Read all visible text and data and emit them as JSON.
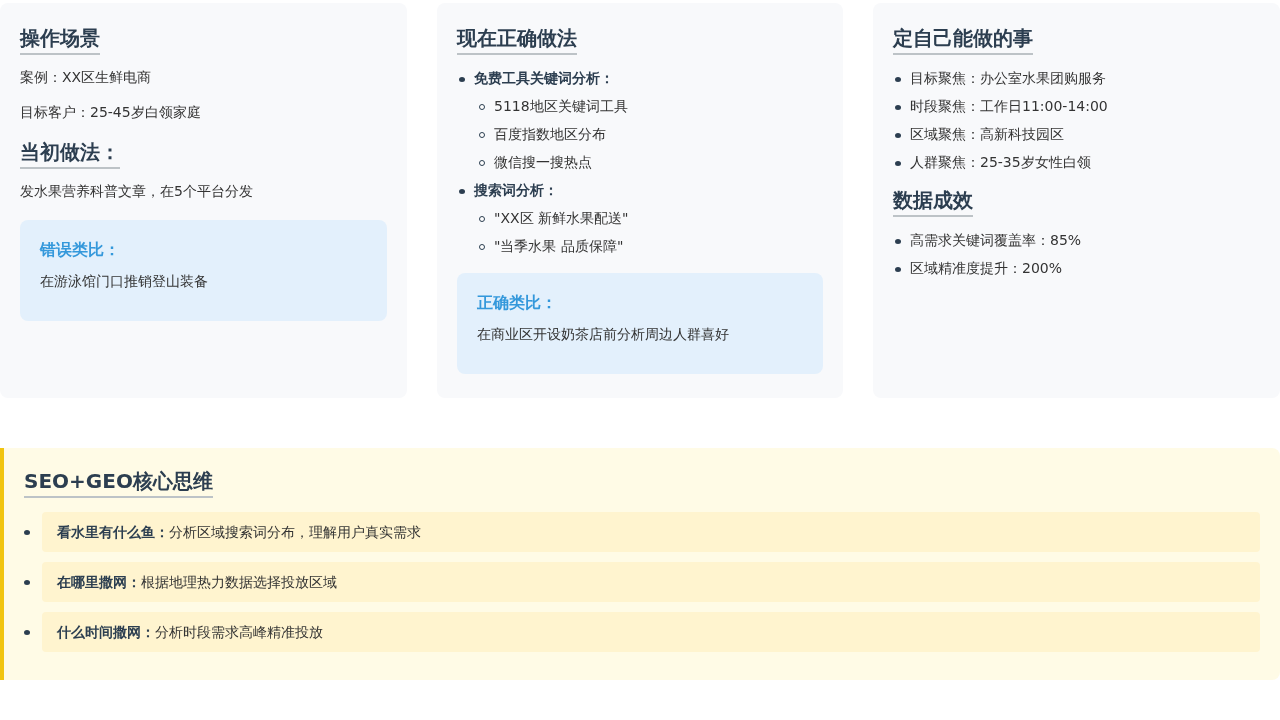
{
  "cards": [
    {
      "blocks": [
        {
          "kind": "heading",
          "text": "操作场景"
        },
        {
          "kind": "paragraph",
          "text": "案例：XX区生鲜电商"
        },
        {
          "kind": "paragraph",
          "text": "目标客户：25-45岁白领家庭"
        },
        {
          "kind": "heading",
          "text": "当初做法："
        },
        {
          "kind": "paragraph",
          "text": "发水果营养科普文章，在5个平台分发"
        },
        {
          "kind": "callout",
          "title": "错误类比：",
          "text": "在游泳馆门口推销登山装备"
        }
      ]
    },
    {
      "blocks": [
        {
          "kind": "heading",
          "text": "现在正确做法"
        },
        {
          "kind": "list",
          "items": [
            {
              "text": "免费工具关键词分析：",
              "children": [
                {
                  "text": "5118地区关键词工具"
                },
                {
                  "text": "百度指数地区分布"
                },
                {
                  "text": "微信搜一搜热点"
                }
              ]
            },
            {
              "text": "搜索词分析：",
              "children": [
                {
                  "text": "\"XX区 新鲜水果配送\""
                },
                {
                  "text": "\"当季水果 品质保障\""
                }
              ]
            }
          ]
        },
        {
          "kind": "callout",
          "title": "正确类比：",
          "text": "在商业区开设奶茶店前分析周边人群喜好"
        }
      ]
    },
    {
      "blocks": [
        {
          "kind": "heading",
          "text": "定自己能做的事"
        },
        {
          "kind": "list",
          "items": [
            {
              "text": "目标聚焦：办公室水果团购服务"
            },
            {
              "text": "时段聚焦：工作日11:00-14:00"
            },
            {
              "text": "区域聚焦：高新科技园区"
            },
            {
              "text": "人群聚焦：25-35岁女性白领"
            }
          ]
        },
        {
          "kind": "heading",
          "text": "数据成效"
        },
        {
          "kind": "list",
          "items": [
            {
              "text": "高需求关键词覆盖率：85%"
            },
            {
              "text": "区域精准度提升：200%"
            }
          ]
        }
      ]
    }
  ],
  "core": {
    "title": "SEO+GEO核心思维",
    "items": [
      {
        "text": "**看水里有什么鱼：**分析区域搜索词分布，理解用户真实需求"
      },
      {
        "text": "**在哪里撒网：**根据地理热力数据选择投放区域"
      },
      {
        "text": "**什么时间撒网：**分析时段需求高峰精准投放"
      }
    ]
  }
}
